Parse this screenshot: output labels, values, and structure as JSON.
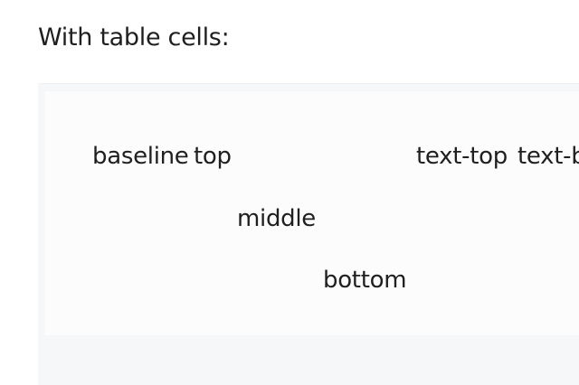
{
  "heading": "With table cells:",
  "cells": {
    "baseline": "baseline",
    "top": "top",
    "text_top": "text-top",
    "text_bottom": "text-bottom",
    "middle": "middle",
    "bottom": "bottom"
  }
}
